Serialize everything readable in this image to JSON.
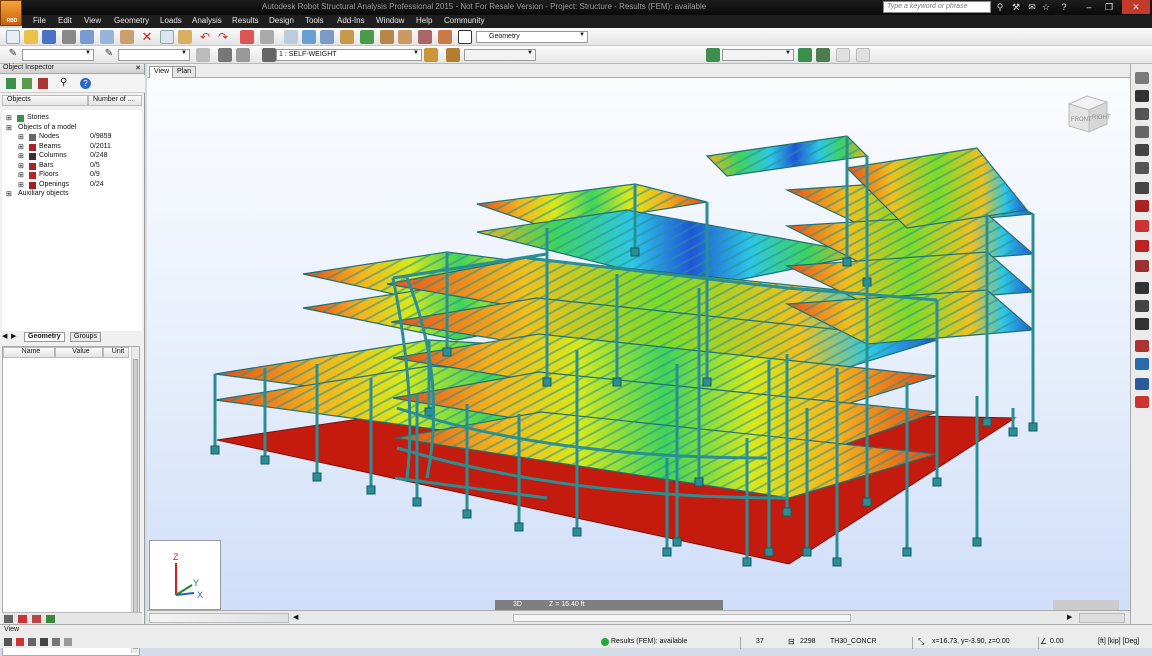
{
  "title_bar": {
    "app_logo_text": "RBD",
    "title": "Autodesk Robot Structural Analysis Professional 2015 - Not For Resale Version - Project: Structure - Results (FEM): available",
    "search_placeholder": "Type a keyword or phrase"
  },
  "menu": [
    "File",
    "Edit",
    "View",
    "Geometry",
    "Loads",
    "Analysis",
    "Results",
    "Design",
    "Tools",
    "Add-Ins",
    "Window",
    "Help",
    "Community"
  ],
  "toolbar": {
    "layout_select": "Geometry",
    "load_case_select": "1 : SELF-WEIGHT"
  },
  "inspector": {
    "title": "Object Inspector",
    "col_objects": "Objects",
    "col_number": "Number of ...",
    "tree": [
      {
        "label": "Stories",
        "count": "",
        "level": 0,
        "icon": "stories-icon"
      },
      {
        "label": "Objects of a model",
        "count": "",
        "level": 0,
        "icon": ""
      },
      {
        "label": "Nodes",
        "count": "0/9859",
        "level": 1,
        "icon": "nodes-icon"
      },
      {
        "label": "Beams",
        "count": "0/2011",
        "level": 1,
        "icon": "beams-icon"
      },
      {
        "label": "Columns",
        "count": "0/248",
        "level": 1,
        "icon": "columns-icon"
      },
      {
        "label": "Bars",
        "count": "0/5",
        "level": 1,
        "icon": "bars-icon"
      },
      {
        "label": "Floors",
        "count": "0/9",
        "level": 1,
        "icon": "floors-icon"
      },
      {
        "label": "Openings",
        "count": "0/24",
        "level": 1,
        "icon": "openings-icon"
      },
      {
        "label": "Auxiliary objects",
        "count": "",
        "level": 0,
        "icon": ""
      }
    ],
    "tabs": [
      "Geometry",
      "Groups"
    ],
    "prop_headers": [
      "Name",
      "Value",
      "Unit"
    ]
  },
  "viewport": {
    "tabs": [
      "View",
      "Plan"
    ],
    "viewcube": {
      "front": "FRONT",
      "right": "RIGHT"
    },
    "axes": {
      "z": "Z",
      "y": "Y",
      "x": "X"
    },
    "mode": "3D",
    "z_level": "Z = 16.40 ft"
  },
  "status": {
    "left_label": "View",
    "results": "Results (FEM): available",
    "node_count": "37",
    "bar_count": "2298",
    "section": "TH30_CONCR",
    "coords": "x=16.73, y=-3.90, z=0.00",
    "value": "0.00",
    "units": "[ft] [kip] [Deg]"
  },
  "colors": {
    "column": "#2a8f95",
    "slab_base": "#c41b0e",
    "contour": [
      "#1f55d8",
      "#2cc7e6",
      "#37d25a",
      "#c5e21a",
      "#f2a81d",
      "#e04418"
    ]
  }
}
